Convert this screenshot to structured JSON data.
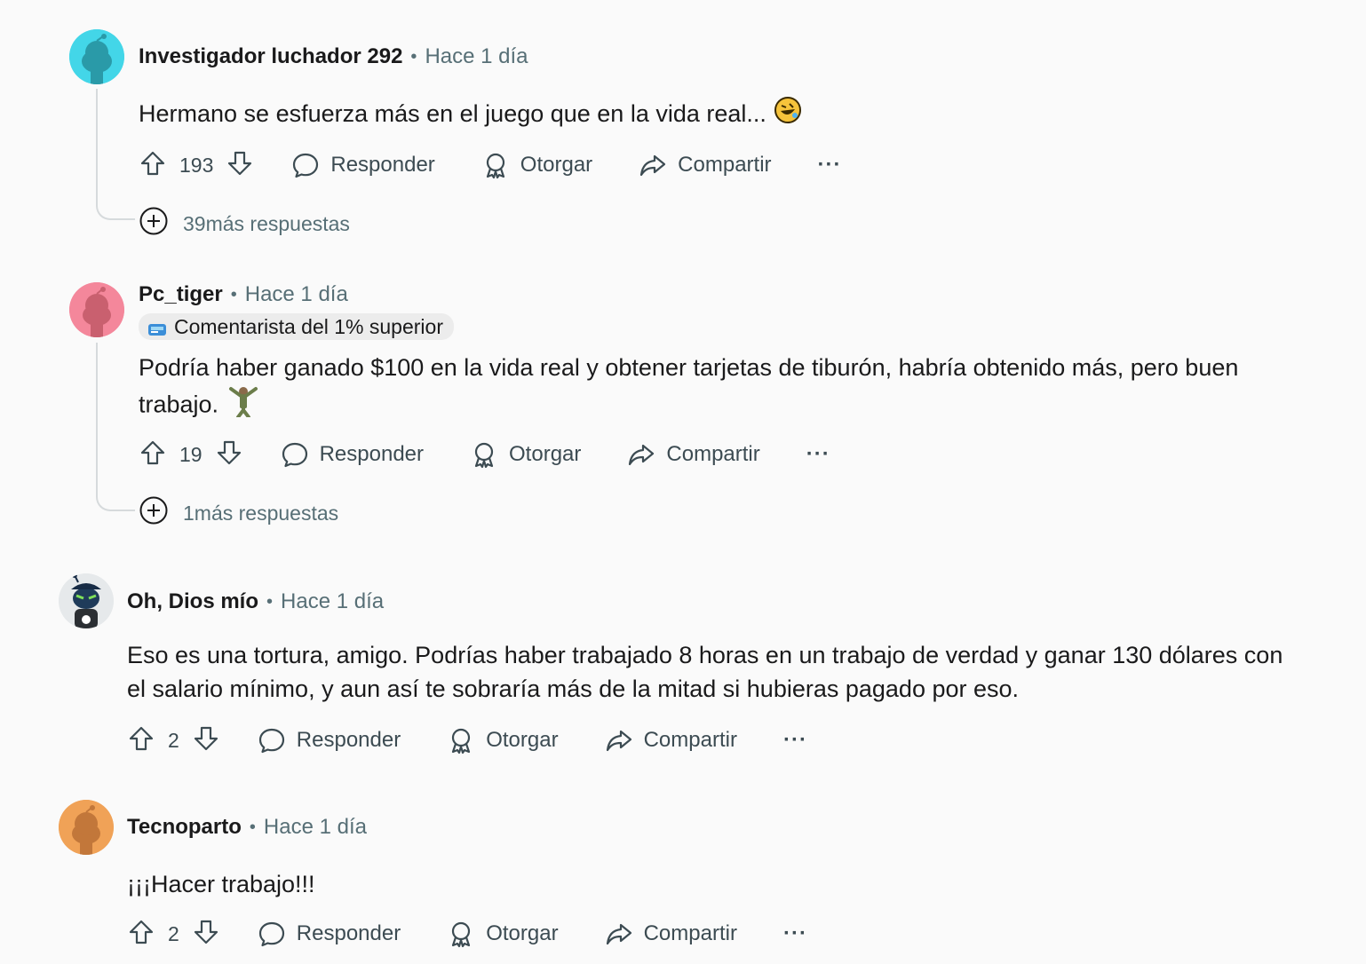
{
  "comments": [
    {
      "author": "Investigador luchador 292",
      "separator": "•",
      "time": "Hace 1 día",
      "avatar_color": "#43d6e8",
      "body": "Hermano se esfuerza más en el juego que en la vida real...",
      "emoji": "rolling-on-floor-laughing",
      "votes": "193",
      "reply": "Responder",
      "award": "Otorgar",
      "share": "Compartir",
      "more_replies": "39más respuestas"
    },
    {
      "author": "Pc_tiger",
      "separator": "•",
      "time": "Hace 1 día",
      "avatar_color": "#f4879b",
      "flair": "Comentarista del 1% superior",
      "body": "Podría haber ganado $100 en la vida real y obtener tarjetas de tiburón, habría obtenido más, pero buen trabajo.",
      "emoji": "person-raising-hands",
      "votes": "19",
      "reply": "Responder",
      "award": "Otorgar",
      "share": "Compartir",
      "more_replies": "1más respuestas"
    },
    {
      "author": "Oh, Dios mío",
      "separator": "•",
      "time": "Hace 1 día",
      "avatar_color": "#e6e9eb",
      "body": "Eso es una tortura, amigo. Podrías haber trabajado 8 horas en un trabajo de verdad y ganar 130 dólares con el salario mínimo, y aun así te sobraría más de la mitad si hubieras pagado por eso.",
      "votes": "2",
      "reply": "Responder",
      "award": "Otorgar",
      "share": "Compartir"
    },
    {
      "author": "Tecnoparto",
      "separator": "•",
      "time": "Hace 1 día",
      "avatar_color": "#f0a257",
      "body": "¡¡¡Hacer trabajo!!!",
      "votes": "2",
      "reply": "Responder",
      "award": "Otorgar",
      "share": "Compartir"
    }
  ],
  "icons": {
    "upvote": "upvote-arrow-icon",
    "downvote": "downvote-arrow-icon",
    "reply": "speech-bubble-icon",
    "award": "award-ribbon-icon",
    "share": "share-arrow-icon",
    "overflow": "ellipsis-icon",
    "expand": "plus-circle-icon"
  },
  "ellipsis": "···"
}
